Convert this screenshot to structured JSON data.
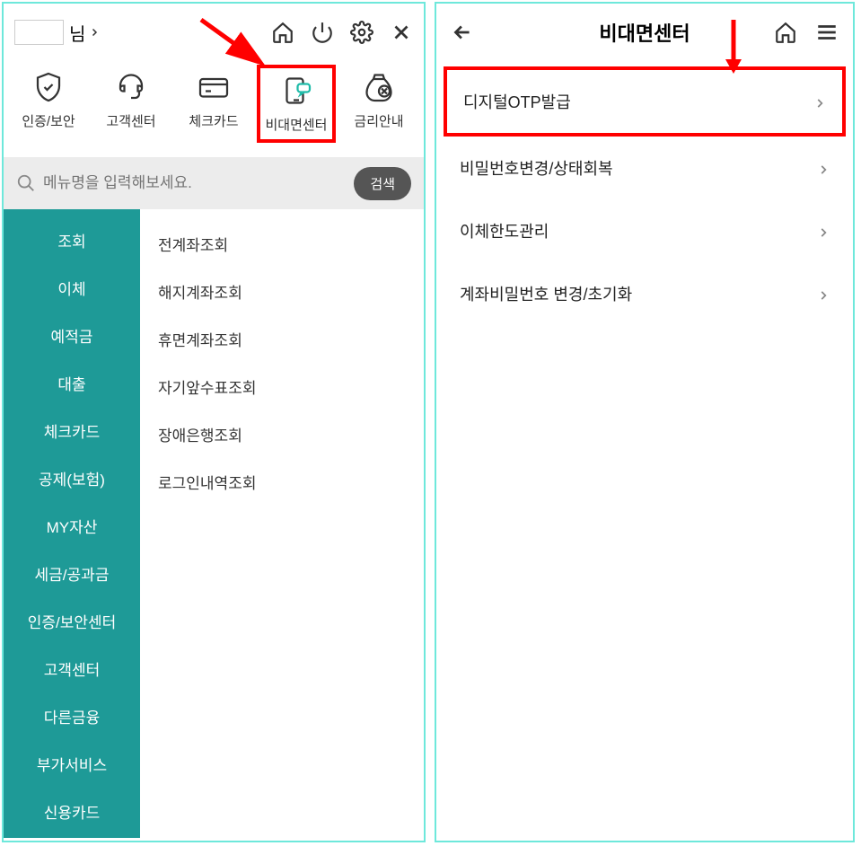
{
  "left": {
    "user_suffix": "님",
    "shortcuts": [
      {
        "label": "인증/보안",
        "icon": "shield-check-icon"
      },
      {
        "label": "고객센터",
        "icon": "headset-icon"
      },
      {
        "label": "체크카드",
        "icon": "card-icon"
      },
      {
        "label": "비대면센터",
        "icon": "device-chat-icon"
      },
      {
        "label": "금리안내",
        "icon": "money-bag-icon"
      }
    ],
    "search": {
      "placeholder": "메뉴명을 입력해보세요.",
      "button": "검색"
    },
    "sidebar": [
      "조회",
      "이체",
      "예적금",
      "대출",
      "체크카드",
      "공제(보험)",
      "MY자산",
      "세금/공과금",
      "인증/보안센터",
      "고객센터",
      "다른금융",
      "부가서비스",
      "신용카드"
    ],
    "menu": [
      "전계좌조회",
      "해지계좌조회",
      "휴면계좌조회",
      "자기앞수표조회",
      "장애은행조회",
      "로그인내역조회"
    ]
  },
  "right": {
    "title": "비대면센터",
    "items": [
      "디지털OTP발급",
      "비밀번호변경/상태회복",
      "이체한도관리",
      "계좌비밀번호 변경/초기화"
    ]
  }
}
